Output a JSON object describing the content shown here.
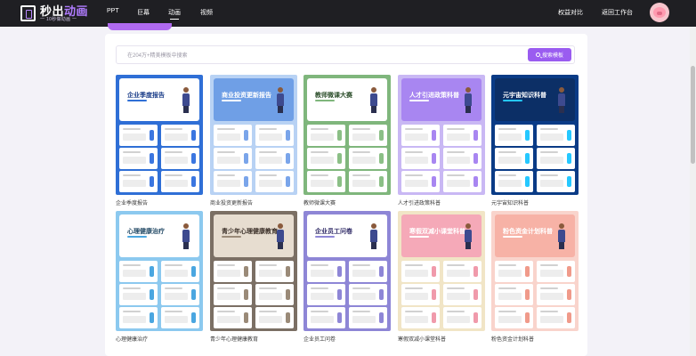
{
  "logo": {
    "title_a": "秒出",
    "title_b": "动画",
    "subtitle": "一 10秒做动画 一"
  },
  "nav": [
    {
      "label": "PPT",
      "active": false
    },
    {
      "label": "巨幕",
      "active": false
    },
    {
      "label": "动画",
      "active": true
    },
    {
      "label": "视频",
      "active": false
    }
  ],
  "top_links": {
    "benefits": "权益对比",
    "workspace": "返回工作台"
  },
  "search": {
    "placeholder": "在204万+精美模板中搜索",
    "button_label": "搜索模板"
  },
  "templates": [
    {
      "caption": "企业季度报告",
      "title": "企业季度报告",
      "bg": "#2f6fd6",
      "hero_bg": "#ffffff",
      "title_color": "#1d3f8a",
      "accent": "#2f6fd6",
      "mini_dot": "#3b76e0"
    },
    {
      "caption": "商业投资更新报告",
      "title": "商业投资更新报告",
      "bg": "#b8d2f4",
      "hero_bg": "#6f9fe6",
      "title_color": "#ffffff",
      "accent": "#ffffff",
      "mini_dot": "#7aa5ea"
    },
    {
      "caption": "教师微课大赛",
      "title": "教师微课大赛",
      "bg": "#7fb67c",
      "hero_bg": "#ffffff",
      "title_color": "#2d4f2c",
      "accent": "#7fb67c",
      "mini_dot": "#8bbf86"
    },
    {
      "caption": "人才引进政策科普",
      "title": "人才引进政策科普",
      "bg": "#c9b8f4",
      "hero_bg": "#a886f1",
      "title_color": "#ffffff",
      "accent": "#ffffff",
      "mini_dot": "#a886f1"
    },
    {
      "caption": "元宇宙知识科普",
      "title": "元宇宙知识科普",
      "bg": "#0a3b86",
      "hero_bg": "#0c2f66",
      "title_color": "#ffffff",
      "accent": "#25c8ff",
      "mini_dot": "#25c8ff"
    },
    {
      "caption": "心理健康治疗",
      "title": "心理健康治疗",
      "bg": "#8cc9ef",
      "hero_bg": "#ffffff",
      "title_color": "#234a66",
      "accent": "#4aa6e0",
      "mini_dot": "#4aa6e0"
    },
    {
      "caption": "青少年心理健康教育",
      "title": "青少年心理健康教育",
      "bg": "#7b6f64",
      "hero_bg": "#e7ddd0",
      "title_color": "#3b2f28",
      "accent": "#9a8a78",
      "mini_dot": "#9a8a78"
    },
    {
      "caption": "企业员工问卷",
      "title": "企业员工问卷",
      "bg": "#8e86d6",
      "hero_bg": "#ffffff",
      "title_color": "#2f2a66",
      "accent": "#8e86d6",
      "mini_dot": "#8e86d6"
    },
    {
      "caption": "寒假双减小课堂科普",
      "title": "寒假双减小课堂科普",
      "bg": "#f1e5c6",
      "hero_bg": "#f5a9b8",
      "title_color": "#ffffff",
      "accent": "#ffffff",
      "mini_dot": "#f09aab"
    },
    {
      "caption": "粉色资金计划科普",
      "title": "粉色资金计划科普",
      "bg": "#f9d4cc",
      "hero_bg": "#f7b2a6",
      "title_color": "#ffffff",
      "accent": "#ffffff",
      "mini_dot": "#f09a8a"
    }
  ]
}
